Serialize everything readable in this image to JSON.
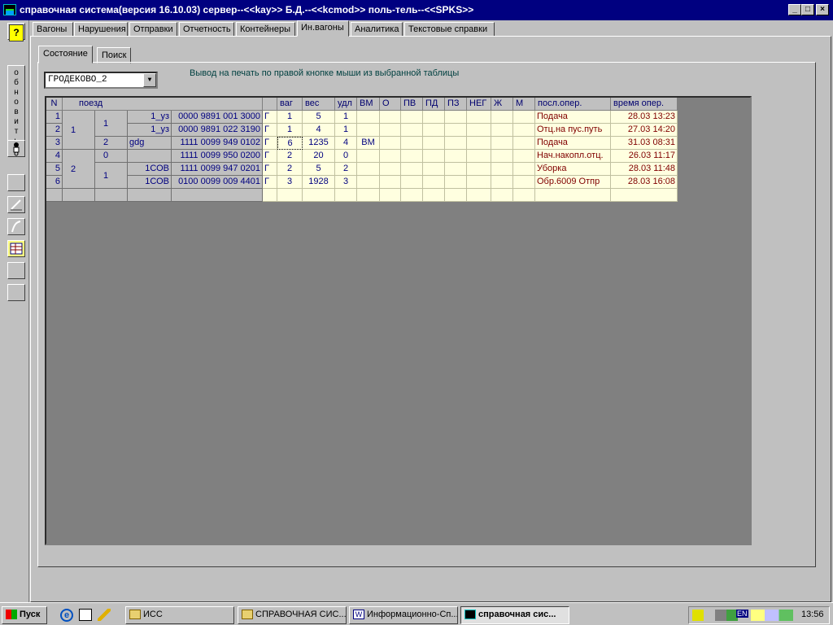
{
  "title": "справочная система(версия 16.10.03) сервер--<<kay>> Б.Д.--<<kcmod>> поль-тель--<<SPKS>>",
  "window_buttons": {
    "minimize": "_",
    "maximize": "□",
    "close": "×"
  },
  "leftbar": {
    "help_label": "?",
    "refresh_letters": [
      "о",
      "б",
      "н",
      "о",
      "в",
      "и",
      "т",
      "ь"
    ]
  },
  "tabs": [
    "Вагоны",
    "Нарушения",
    "Отправки",
    "Отчетность",
    "Контейнеры",
    "Ин.вагоны",
    "Аналитика",
    "Текстовые справки"
  ],
  "active_tab": "Ин.вагоны",
  "subtabs": [
    "Состояние",
    "Поиск"
  ],
  "station_combo": {
    "value": "ГРОДЕКОВО_2"
  },
  "print_hint": "Вывод на печать по правой кнопке мыши из выбранной таблицы",
  "left_grid": {
    "headers": [
      "N",
      "поезд"
    ],
    "rows_n": [
      "1",
      "2",
      "3",
      "4",
      "5",
      "6"
    ],
    "train_groups": [
      "1",
      "2"
    ],
    "sub_groups": [
      "1",
      "2",
      "0",
      "1"
    ],
    "codes": [
      "",
      "",
      "gdg",
      "",
      "",
      ""
    ],
    "names": [
      "1_уз",
      "1_уз",
      "",
      "",
      "1СОВ",
      "1СОВ"
    ],
    "numbers": [
      "0000 9891 001 3000",
      "0000 9891 022 3190",
      "1111 0099 949 0102",
      "1111 0099 950 0200",
      "1111 0099 947 0201",
      "0100 0099 009 4401"
    ]
  },
  "right_grid": {
    "headers": [
      "ваг",
      "вес",
      "удл",
      "ВМ",
      "О",
      "ПВ",
      "ПД",
      "ПЗ",
      "НЕГ",
      "Ж",
      "М",
      "посл.опер.",
      "время опер."
    ],
    "rows": [
      {
        "g": "Г",
        "vag": "1",
        "ves": "5",
        "udl": "1",
        "vm": "",
        "op": "Подача",
        "time": "28.03 13:23"
      },
      {
        "g": "Г",
        "vag": "1",
        "ves": "4",
        "udl": "1",
        "vm": "",
        "op": "Отц.на пус.путь",
        "time": "27.03 14:20"
      },
      {
        "g": "Г",
        "vag": "6",
        "ves": "1235",
        "udl": "4",
        "vm": "ВМ",
        "op": "Подача",
        "time": "31.03 08:31"
      },
      {
        "g": "Г",
        "vag": "2",
        "ves": "20",
        "udl": "0",
        "vm": "",
        "op": "Нач.накопл.отц.",
        "time": "26.03 11:17"
      },
      {
        "g": "Г",
        "vag": "2",
        "ves": "5",
        "udl": "2",
        "vm": "",
        "op": "Уборка",
        "time": "28.03 11:48"
      },
      {
        "g": "Г",
        "vag": "3",
        "ves": "1928",
        "udl": "3",
        "vm": "",
        "op": "Обр.6009 Отпр",
        "time": "28.03 16:08"
      }
    ]
  },
  "taskbar": {
    "start": "Пуск",
    "buttons": [
      "ИСС",
      "СПРАВОЧНАЯ СИС...",
      "Информационно-Сп...",
      "справочная сис..."
    ],
    "clock": "13:56",
    "lang": "EN"
  }
}
